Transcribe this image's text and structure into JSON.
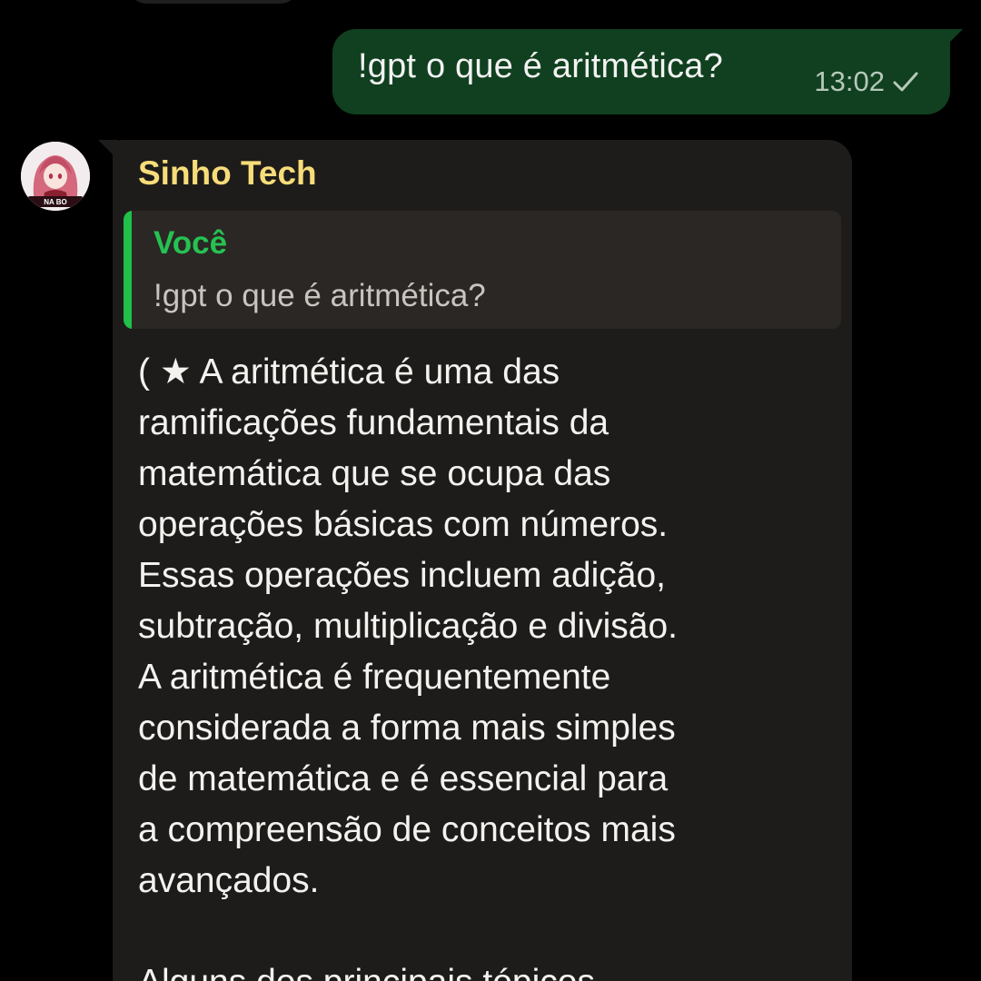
{
  "colors": {
    "background": "#000000",
    "outgoing_bubble": "#10401f",
    "incoming_bubble": "#1e1c1a",
    "sender_name": "#f7dc7a",
    "quote_accent": "#21c04a"
  },
  "outgoing_message": {
    "text": "!gpt o que é aritmética?",
    "time": "13:02",
    "status_icon": "check-icon"
  },
  "incoming_message": {
    "avatar_icon": "bot-avatar-icon",
    "sender": "Sinho Tech",
    "quoted": {
      "author": "Você",
      "text": "!gpt o que é aritmética?"
    },
    "body_lines": [
      "( ★ A aritmética é uma das",
      "ramificações fundamentais da",
      "matemática que se ocupa das",
      "operações básicas com números.",
      "Essas operações incluem adição,",
      "subtração, multiplicação e divisão.",
      "A aritmética é frequentemente",
      "considerada a forma mais simples",
      "de matemática e é essencial para",
      "a compreensão de conceitos mais",
      "avançados.",
      "",
      "Alguns dos principais tópicos"
    ]
  }
}
